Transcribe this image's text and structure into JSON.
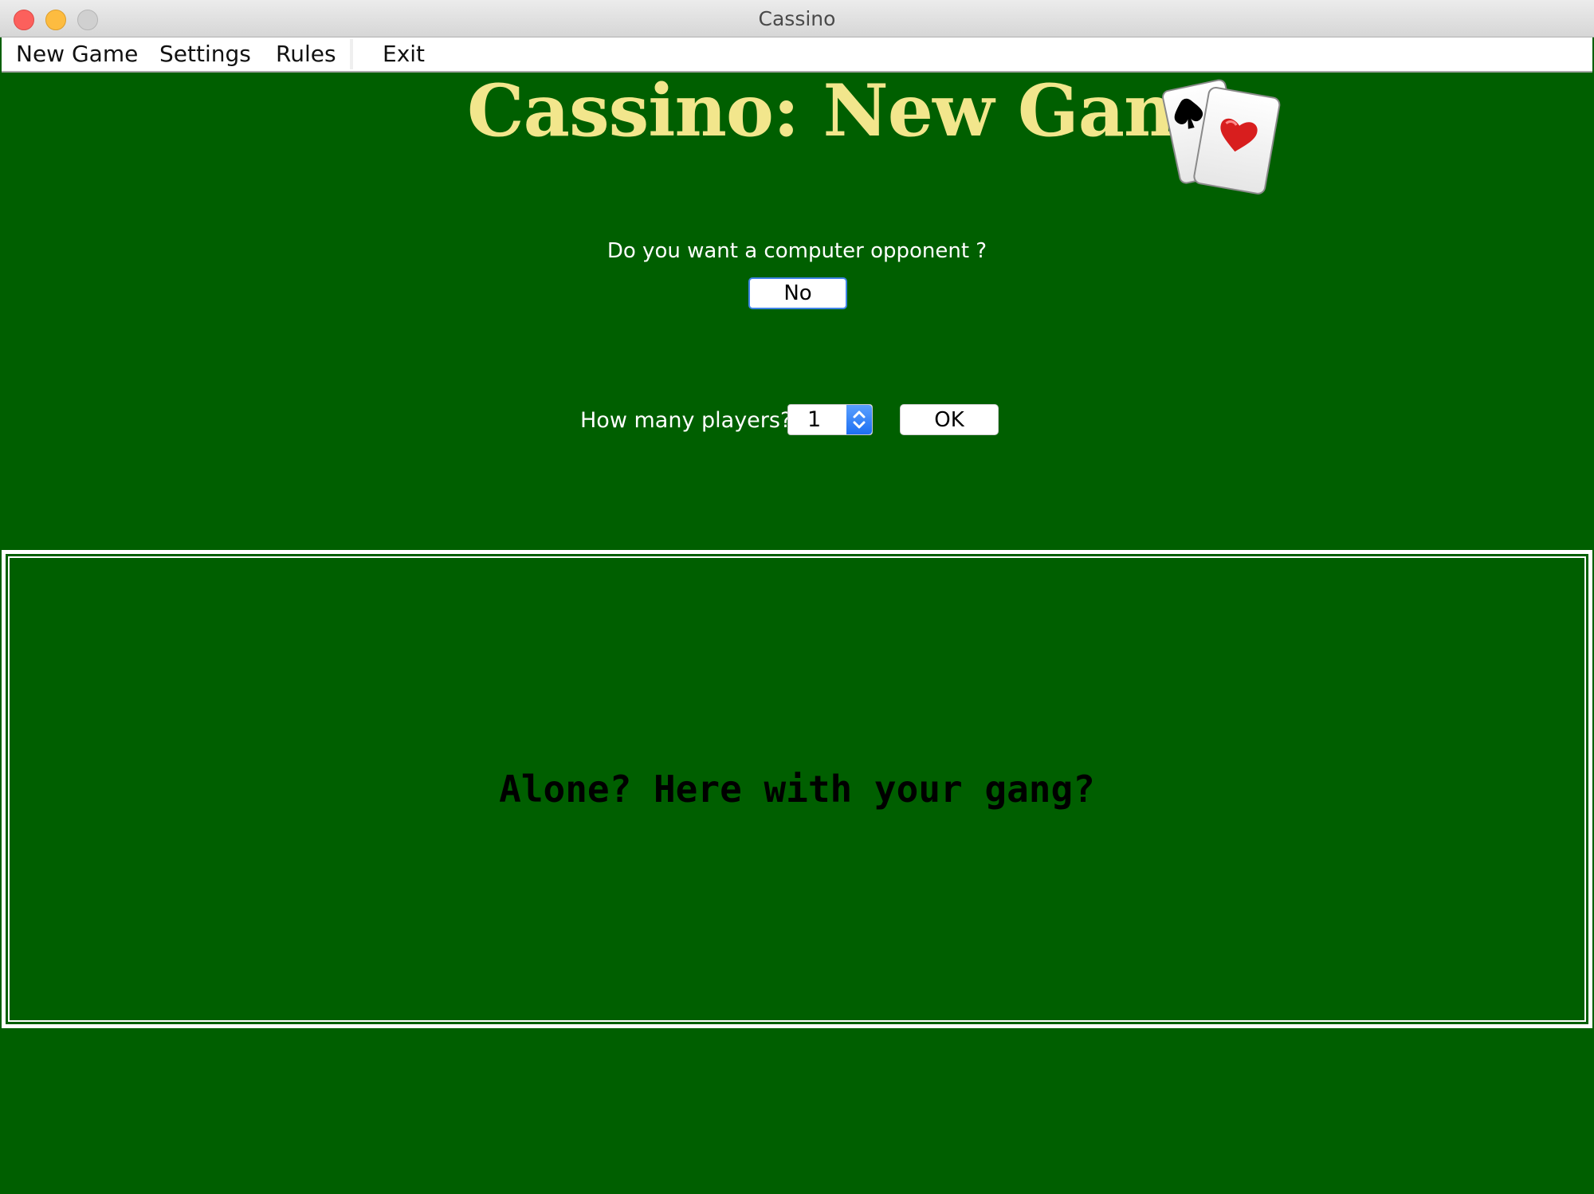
{
  "window": {
    "title": "Cassino"
  },
  "menu": {
    "items": [
      "New Game",
      "Settings",
      "Rules",
      "Exit"
    ]
  },
  "header": {
    "title": "Cassino: New Game",
    "icon": "playing-cards-icon"
  },
  "opponent": {
    "question": "Do you want a computer opponent ?",
    "button_label": "No"
  },
  "players": {
    "label": "How many players?",
    "value": "1",
    "ok_label": "OK"
  },
  "panel": {
    "message": "Alone? Here with your gang?"
  },
  "colors": {
    "table_green": "#005f00",
    "title_yellow": "#f2e68c",
    "focus_blue": "#3f84e6"
  }
}
